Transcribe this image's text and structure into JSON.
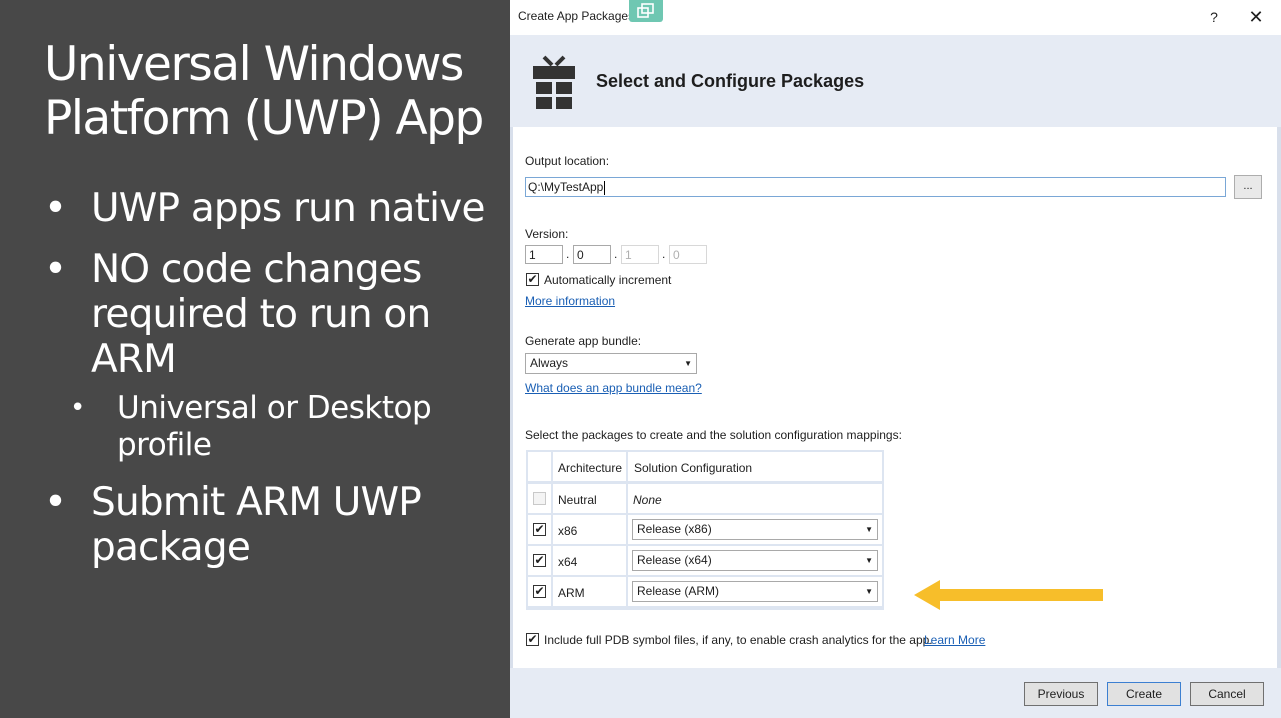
{
  "slide": {
    "title_lines": [
      "Universal Windows",
      "Platform (UWP) App"
    ],
    "bullets": [
      {
        "text": "UWP apps run native",
        "level": 1
      },
      {
        "text": "NO code changes required to run on ARM",
        "level": 1
      },
      {
        "text": "Universal or Desktop profile",
        "level": 2
      },
      {
        "text": "Submit ARM UWP package",
        "level": 1
      }
    ],
    "bullet_glyph": "•"
  },
  "dialog": {
    "title": "Create App Packages",
    "help_glyph": "?",
    "close_glyph": "✕",
    "header_title": "Select and Configure Packages",
    "output": {
      "label": "Output location:",
      "value": "Q:\\MyTestApp",
      "browse_label": "..."
    },
    "version": {
      "label": "Version:",
      "parts": [
        "1",
        "0",
        "1",
        "0"
      ],
      "separator": ".",
      "auto_increment_label": "Automatically increment",
      "auto_increment_checked": true,
      "more_info_link": "More information"
    },
    "bundle": {
      "label": "Generate app bundle:",
      "selected": "Always",
      "help_link": "What does an app bundle mean?"
    },
    "packages": {
      "instruction": "Select the packages to create and the solution configuration mappings:",
      "col_architecture": "Architecture",
      "col_configuration": "Solution Configuration",
      "rows": [
        {
          "arch": "Neutral",
          "config": "None",
          "checked": false,
          "editable": false
        },
        {
          "arch": "x86",
          "config": "Release (x86)",
          "checked": true,
          "editable": true
        },
        {
          "arch": "x64",
          "config": "Release (x64)",
          "checked": true,
          "editable": true
        },
        {
          "arch": "ARM",
          "config": "Release (ARM)",
          "checked": true,
          "editable": true
        }
      ]
    },
    "pdb": {
      "label": "Include full PDB symbol files, if any, to enable crash analytics for the app.",
      "checked": true,
      "learn_more_link": "Learn More"
    },
    "buttons": {
      "previous": "Previous",
      "create": "Create",
      "cancel": "Cancel"
    },
    "icons": {
      "header": "gift-package-icon",
      "titlebar": "restore-window-icon",
      "annotation": "left-arrow-icon"
    },
    "colors": {
      "header_band": "#e6ebf4",
      "arrow": "#f7be2a",
      "slide_bg": "#484848",
      "link": "#1a5fb4"
    }
  }
}
